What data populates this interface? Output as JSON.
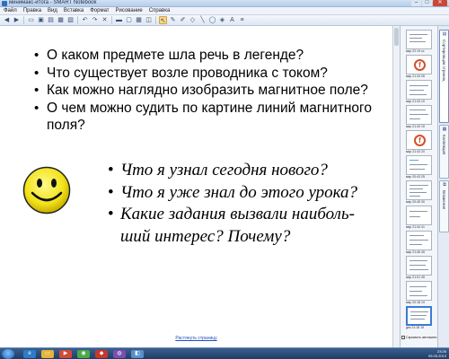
{
  "window": {
    "title": "минимакс-итога - SMART Notebook"
  },
  "menu": [
    "Файл",
    "Правка",
    "Вид",
    "Вставка",
    "Формат",
    "Рисование",
    "Справка"
  ],
  "toolbar_icons": [
    "back-icon",
    "forward-icon",
    "add-page-icon",
    "delete-page-icon",
    "open-icon",
    "save-icon",
    "paste-icon",
    "undo-icon",
    "redo-icon",
    "delete-icon",
    "screen-shade-icon",
    "full-screen-icon",
    "table-icon",
    "screen-capture-icon",
    "select-icon",
    "pen-icon",
    "creative-pen-icon",
    "eraser-icon",
    "line-icon",
    "shape-icon",
    "fill-icon",
    "text-icon",
    "properties-icon"
  ],
  "questions": [
    "О каком предмете шла речь в легенде?",
    "Что существует возле проводника с током?",
    "Как можно наглядно изобразить магнитное поле?",
    "О чем можно судить по картине линий магнитного поля?"
  ],
  "reflection": [
    "Что я узнал сегодня нового?",
    "Что я уже знал до этого урока?",
    "Какие задания вызвали наиболь-ший интерес? Почему?"
  ],
  "page_link": "Растянуть страницу",
  "side_panel": {
    "thumbnails": [
      "мар 22:19 сс",
      "мар 21:43 05",
      "мар 21:43 10",
      "мар 21:43 15",
      "мар 21:43 20",
      "мар 20:43 25",
      "мар 20:45 30",
      "мар 21:44 41",
      "мар 21:46 45",
      "мар 21:01 45",
      "мар 20:18 19",
      "дек 21:18 19"
    ],
    "hide_automatically_label": "Скрывать автомати"
  },
  "side_tabs": [
    "Сортировщик страниц",
    "Коллекция",
    "Вложения"
  ],
  "taskbar": {
    "time": "23:26",
    "date": "05.05.2013"
  }
}
